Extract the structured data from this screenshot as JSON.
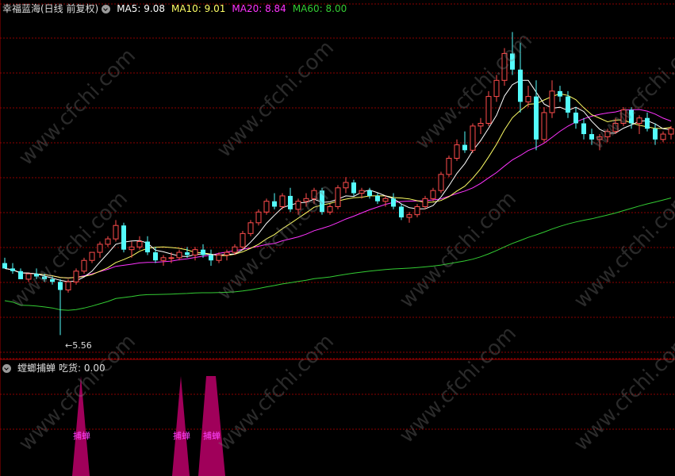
{
  "header": {
    "stock_title": "幸福蓝海(日线 前复权)",
    "ma5": "MA5: 9.08",
    "ma10": "MA10: 9.01",
    "ma20": "MA20: 8.84",
    "ma60": "MA60: 8.00"
  },
  "sub_header": {
    "indicator": "螳螂捕蝉",
    "value": "吃货: 0.00"
  },
  "low_marker": "5.56",
  "watermark": "www.cfchi.com",
  "colors": {
    "up": "#ff4d4d",
    "down": "#54fcfc",
    "ma5": "#ffffff",
    "ma10": "#ffff66",
    "ma20": "#ff33ff",
    "ma60": "#33cc33",
    "grid": "#8b0000",
    "signal": "#a0005a",
    "signal_text": "#ff44ff"
  },
  "chart_data": {
    "type": "candlestick",
    "ylim": [
      5.3,
      11.5
    ],
    "count": 120,
    "ohlc_approx": [
      [
        6.9,
        7.0,
        6.8,
        6.8
      ],
      [
        6.8,
        6.9,
        6.7,
        6.75
      ],
      [
        6.75,
        6.8,
        6.6,
        6.6
      ],
      [
        6.6,
        6.7,
        6.55,
        6.7
      ],
      [
        6.7,
        6.8,
        6.6,
        6.65
      ],
      [
        6.65,
        6.7,
        6.55,
        6.6
      ],
      [
        6.6,
        6.65,
        6.5,
        6.55
      ],
      [
        6.55,
        6.6,
        5.56,
        6.4
      ],
      [
        6.4,
        6.6,
        6.35,
        6.55
      ],
      [
        6.55,
        6.8,
        6.5,
        6.75
      ],
      [
        6.75,
        7.0,
        6.7,
        6.95
      ],
      [
        6.95,
        7.1,
        6.9,
        7.1
      ],
      [
        7.1,
        7.3,
        7.0,
        7.25
      ],
      [
        7.25,
        7.4,
        7.2,
        7.35
      ],
      [
        7.35,
        7.7,
        7.3,
        7.6
      ],
      [
        7.6,
        7.65,
        7.1,
        7.15
      ],
      [
        7.15,
        7.3,
        7.0,
        7.2
      ],
      [
        7.2,
        7.4,
        7.15,
        7.3
      ],
      [
        7.3,
        7.4,
        7.05,
        7.1
      ],
      [
        7.1,
        7.2,
        6.9,
        6.95
      ],
      [
        6.95,
        7.05,
        6.85,
        7.0
      ],
      [
        7.0,
        7.1,
        6.9,
        7.0
      ],
      [
        7.0,
        7.15,
        6.95,
        7.1
      ],
      [
        7.1,
        7.2,
        7.0,
        7.05
      ],
      [
        7.05,
        7.2,
        6.95,
        7.15
      ],
      [
        7.15,
        7.25,
        7.0,
        7.05
      ],
      [
        7.05,
        7.15,
        6.85,
        6.95
      ],
      [
        6.95,
        7.1,
        6.9,
        7.05
      ],
      [
        7.05,
        7.15,
        6.95,
        7.1
      ],
      [
        7.1,
        7.25,
        7.05,
        7.2
      ],
      [
        7.2,
        7.5,
        7.15,
        7.45
      ],
      [
        7.45,
        7.7,
        7.4,
        7.65
      ],
      [
        7.65,
        7.9,
        7.6,
        7.85
      ],
      [
        7.85,
        8.1,
        7.8,
        8.05
      ],
      [
        8.05,
        8.2,
        7.9,
        7.95
      ],
      [
        7.95,
        8.2,
        7.9,
        8.15
      ],
      [
        8.15,
        8.3,
        7.85,
        7.9
      ],
      [
        7.9,
        8.1,
        7.8,
        8.05
      ],
      [
        8.05,
        8.2,
        7.95,
        8.1
      ],
      [
        8.1,
        8.3,
        8.0,
        8.25
      ],
      [
        8.25,
        8.3,
        7.8,
        7.85
      ],
      [
        7.85,
        8.0,
        7.8,
        7.95
      ],
      [
        7.95,
        8.35,
        7.9,
        8.3
      ],
      [
        8.3,
        8.5,
        8.2,
        8.4
      ],
      [
        8.4,
        8.45,
        8.15,
        8.2
      ],
      [
        8.2,
        8.3,
        8.1,
        8.25
      ],
      [
        8.25,
        8.3,
        8.1,
        8.15
      ],
      [
        8.15,
        8.2,
        8.0,
        8.05
      ],
      [
        8.05,
        8.15,
        7.95,
        8.1
      ],
      [
        8.1,
        8.2,
        7.9,
        7.95
      ],
      [
        7.95,
        8.0,
        7.7,
        7.75
      ],
      [
        7.75,
        7.85,
        7.65,
        7.8
      ],
      [
        7.8,
        8.0,
        7.75,
        7.95
      ],
      [
        7.95,
        8.15,
        7.9,
        8.1
      ],
      [
        8.1,
        8.3,
        8.05,
        8.25
      ],
      [
        8.25,
        8.6,
        8.2,
        8.55
      ],
      [
        8.55,
        8.9,
        8.5,
        8.85
      ],
      [
        8.85,
        9.2,
        8.8,
        9.1
      ],
      [
        9.1,
        9.35,
        8.95,
        9.0
      ],
      [
        9.0,
        9.5,
        8.95,
        9.45
      ],
      [
        9.45,
        9.6,
        9.3,
        9.5
      ],
      [
        9.5,
        10.1,
        9.45,
        10.0
      ],
      [
        10.0,
        10.4,
        9.9,
        10.3
      ],
      [
        10.3,
        10.9,
        10.2,
        10.8
      ],
      [
        10.8,
        11.2,
        10.4,
        10.5
      ],
      [
        10.5,
        11.0,
        9.7,
        9.9
      ],
      [
        9.9,
        10.2,
        9.8,
        10.0
      ],
      [
        10.0,
        10.3,
        9.0,
        9.2
      ],
      [
        9.2,
        9.8,
        9.15,
        9.7
      ],
      [
        9.7,
        10.3,
        9.6,
        10.1
      ],
      [
        10.1,
        10.2,
        9.9,
        10.0
      ],
      [
        10.0,
        10.1,
        9.6,
        9.7
      ],
      [
        9.7,
        9.8,
        9.4,
        9.5
      ],
      [
        9.5,
        9.6,
        9.2,
        9.3
      ],
      [
        9.3,
        9.4,
        9.1,
        9.2
      ],
      [
        9.2,
        9.3,
        9.0,
        9.25
      ],
      [
        9.25,
        9.4,
        9.15,
        9.35
      ],
      [
        9.35,
        9.6,
        9.3,
        9.5
      ],
      [
        9.5,
        9.8,
        9.45,
        9.75
      ],
      [
        9.75,
        9.8,
        9.4,
        9.5
      ],
      [
        9.5,
        9.65,
        9.3,
        9.6
      ],
      [
        9.6,
        9.7,
        9.35,
        9.4
      ],
      [
        9.4,
        9.5,
        9.1,
        9.2
      ],
      [
        9.2,
        9.35,
        9.15,
        9.3
      ],
      [
        9.3,
        9.45,
        9.2,
        9.4
      ]
    ]
  }
}
